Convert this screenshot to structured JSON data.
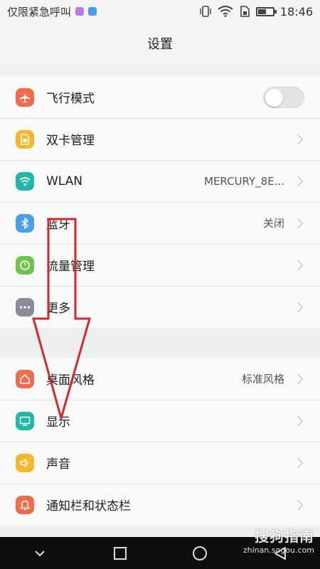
{
  "status_bar": {
    "carrier": "仅限紧急呼叫",
    "time": "18:46",
    "battery_level": 0.5,
    "icons": [
      "vibrate-icon",
      "wifi-icon",
      "sim-icon",
      "battery-icon"
    ]
  },
  "title": "设置",
  "group1": [
    {
      "id": "airplane",
      "label": "飞行模式",
      "icon": "airplane-icon",
      "color": "#f26b4a",
      "control": "toggle",
      "toggle_on": false
    },
    {
      "id": "dualsim",
      "label": "双卡管理",
      "icon": "sim-card-icon",
      "color": "#f6b72b",
      "control": "chevron"
    },
    {
      "id": "wlan",
      "label": "WLAN",
      "value": "MERCURY_8E...",
      "icon": "wifi-icon",
      "color": "#21b8a8",
      "control": "chevron"
    },
    {
      "id": "bluetooth",
      "label": "蓝牙",
      "value": "关闭",
      "icon": "bluetooth-icon",
      "color": "#4a9fe8",
      "control": "chevron"
    },
    {
      "id": "data",
      "label": "流量管理",
      "icon": "data-usage-icon",
      "color": "#6fc24a",
      "control": "chevron"
    },
    {
      "id": "more",
      "label": "更多",
      "icon": "more-icon",
      "color": "#8c8c98",
      "control": "chevron"
    }
  ],
  "group2": [
    {
      "id": "home",
      "label": "桌面风格",
      "value": "标准风格",
      "icon": "home-icon",
      "color": "#f26b4a",
      "control": "chevron"
    },
    {
      "id": "display",
      "label": "显示",
      "icon": "display-icon",
      "color": "#21b8a8",
      "control": "chevron"
    },
    {
      "id": "sound",
      "label": "声音",
      "icon": "sound-icon",
      "color": "#f6b72b",
      "control": "chevron"
    },
    {
      "id": "notify",
      "label": "通知栏和状态栏",
      "icon": "notification-icon",
      "color": "#f26b4a",
      "control": "chevron"
    }
  ],
  "nav": [
    "collapse-icon",
    "recent-apps-icon",
    "home-circle-icon",
    "back-icon"
  ],
  "watermark": {
    "brand": "搜狗指南",
    "url": "zhinan.sogou.com"
  },
  "accent_colors": {
    "annotation_arrow": "#d22a2a"
  }
}
